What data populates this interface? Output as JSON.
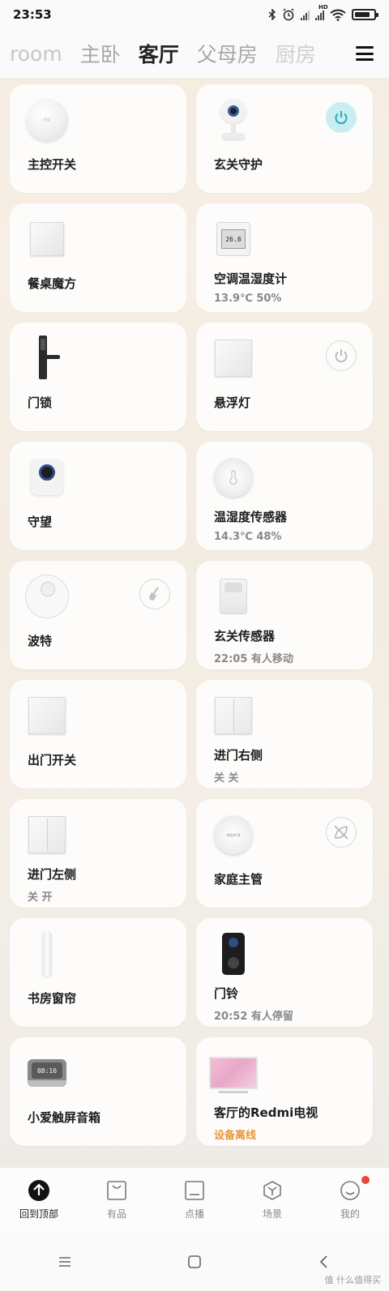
{
  "status_bar": {
    "time": "23:53",
    "sim_label_1": "HD",
    "sim_label_2": "HD"
  },
  "room_tabs": [
    {
      "label": "room",
      "state": "partial"
    },
    {
      "label": "主卧",
      "state": "inactive"
    },
    {
      "label": "客厅",
      "state": "active"
    },
    {
      "label": "父母房",
      "state": "inactive"
    },
    {
      "label": "厨房",
      "state": "partial"
    }
  ],
  "devices": [
    {
      "name": "主控开关",
      "status": "",
      "icon": "gateway-icon",
      "action": ""
    },
    {
      "name": "玄关守护",
      "status": "",
      "icon": "camera-icon",
      "action": "power-on"
    },
    {
      "name": "餐桌魔方",
      "status": "",
      "icon": "cube-icon",
      "action": ""
    },
    {
      "name": "空调温湿度计",
      "status": "13.9℃ 50%",
      "icon": "thermometer-display-icon",
      "action": "",
      "display": "26.8"
    },
    {
      "name": "门锁",
      "status": "",
      "icon": "door-lock-icon",
      "action": ""
    },
    {
      "name": "悬浮灯",
      "status": "",
      "icon": "light-switch-icon",
      "action": "power-off"
    },
    {
      "name": "守望",
      "status": "",
      "icon": "security-camera-icon",
      "action": ""
    },
    {
      "name": "温湿度传感器",
      "status": "14.3℃ 48%",
      "icon": "temperature-sensor-icon",
      "action": ""
    },
    {
      "name": "波特",
      "status": "",
      "icon": "robot-vacuum-icon",
      "action": "sweep"
    },
    {
      "name": "玄关传感器",
      "status": "22:05 有人移动",
      "icon": "motion-sensor-icon",
      "action": ""
    },
    {
      "name": "出门开关",
      "status": "",
      "icon": "wall-switch-icon",
      "action": ""
    },
    {
      "name": "进门右侧",
      "status": "关 关",
      "icon": "double-switch-icon",
      "action": ""
    },
    {
      "name": "进门左侧",
      "status": "关 开",
      "icon": "double-switch-icon",
      "action": ""
    },
    {
      "name": "家庭主管",
      "status": "",
      "icon": "hub-icon",
      "action": "offline"
    },
    {
      "name": "书房窗帘",
      "status": "",
      "icon": "curtain-icon",
      "action": ""
    },
    {
      "name": "门铃",
      "status": "20:52 有人停留",
      "icon": "doorbell-icon",
      "action": ""
    },
    {
      "name": "小爱触屏音箱",
      "status": "",
      "icon": "smart-speaker-icon",
      "action": "",
      "display": "08:16"
    },
    {
      "name": "客厅的Redmi电视",
      "status": "设备离线",
      "icon": "tv-icon",
      "action": "",
      "status_color": "#e8963a"
    }
  ],
  "bottom_nav": [
    {
      "label": "回到顶部",
      "icon": "back-to-top-icon",
      "active": true
    },
    {
      "label": "有品",
      "icon": "shopping-bag-icon",
      "active": false
    },
    {
      "label": "点播",
      "icon": "play-icon",
      "active": false
    },
    {
      "label": "场景",
      "icon": "scene-icon",
      "active": false
    },
    {
      "label": "我的",
      "icon": "profile-icon",
      "active": false,
      "badge": true
    }
  ],
  "watermark": "值 什么值得买",
  "colors": {
    "accent_on": "#c9eef2",
    "warning_text": "#e8963a",
    "badge": "#e8453c"
  }
}
